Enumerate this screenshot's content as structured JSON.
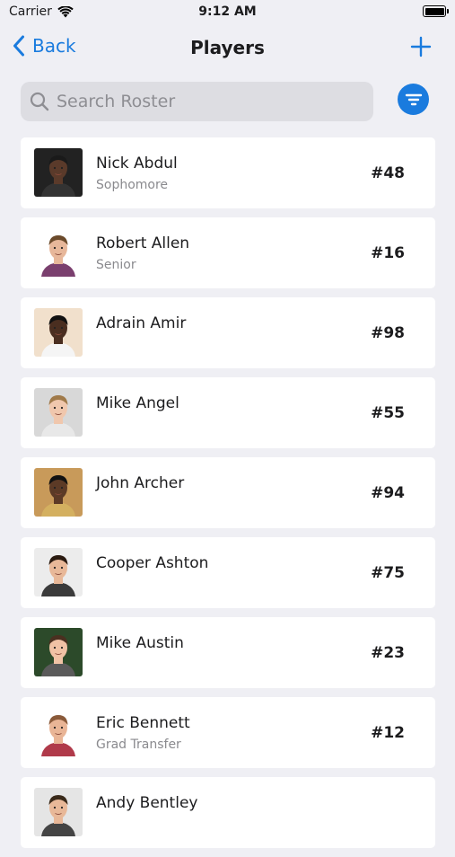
{
  "status_bar": {
    "carrier": "Carrier",
    "time": "9:12 AM"
  },
  "nav": {
    "back_label": "Back",
    "title": "Players"
  },
  "search": {
    "placeholder": "Search Roster",
    "value": ""
  },
  "colors": {
    "accent": "#1a7bde",
    "background": "#efeff4",
    "card": "#ffffff"
  },
  "players": [
    {
      "name": "Nick Abdul",
      "class": "Sophomore",
      "number": "#48",
      "skin": "#5a3a2a",
      "hair": "#1a1a1a",
      "bg": "#222222",
      "shirt": "#333333"
    },
    {
      "name": "Robert Allen",
      "class": "Senior",
      "number": "#16",
      "skin": "#e7b79a",
      "hair": "#6b4a2b",
      "bg": "#ffffff",
      "shirt": "#7a3f6e"
    },
    {
      "name": "Adrain Amir",
      "class": "",
      "number": "#98",
      "skin": "#4a2e20",
      "hair": "#111111",
      "bg": "#f1e0cc",
      "shirt": "#f5f5f5"
    },
    {
      "name": "Mike Angel",
      "class": "",
      "number": "#55",
      "skin": "#f0c7ad",
      "hair": "#a07a4a",
      "bg": "#d8d8d8",
      "shirt": "#e8e8e8"
    },
    {
      "name": "John Archer",
      "class": "",
      "number": "#94",
      "skin": "#5c3a26",
      "hair": "#111111",
      "bg": "#c89a5a",
      "shirt": "#d4b060"
    },
    {
      "name": "Cooper Ashton",
      "class": "",
      "number": "#75",
      "skin": "#e8b898",
      "hair": "#2a1a10",
      "bg": "#ececec",
      "shirt": "#3a3a3a"
    },
    {
      "name": "Mike Austin",
      "class": "",
      "number": "#23",
      "skin": "#f0c2a5",
      "hair": "#4a3020",
      "bg": "#2c4a2a",
      "shirt": "#5a5a5a"
    },
    {
      "name": "Eric Bennett",
      "class": "Grad Transfer",
      "number": "#12",
      "skin": "#e9b596",
      "hair": "#8a5a3a",
      "bg": "#ffffff",
      "shirt": "#b03a4a"
    },
    {
      "name": "Andy Bentley",
      "class": "",
      "number": "",
      "skin": "#e8b898",
      "hair": "#3a2a1a",
      "bg": "#e5e5e5",
      "shirt": "#444444"
    }
  ]
}
